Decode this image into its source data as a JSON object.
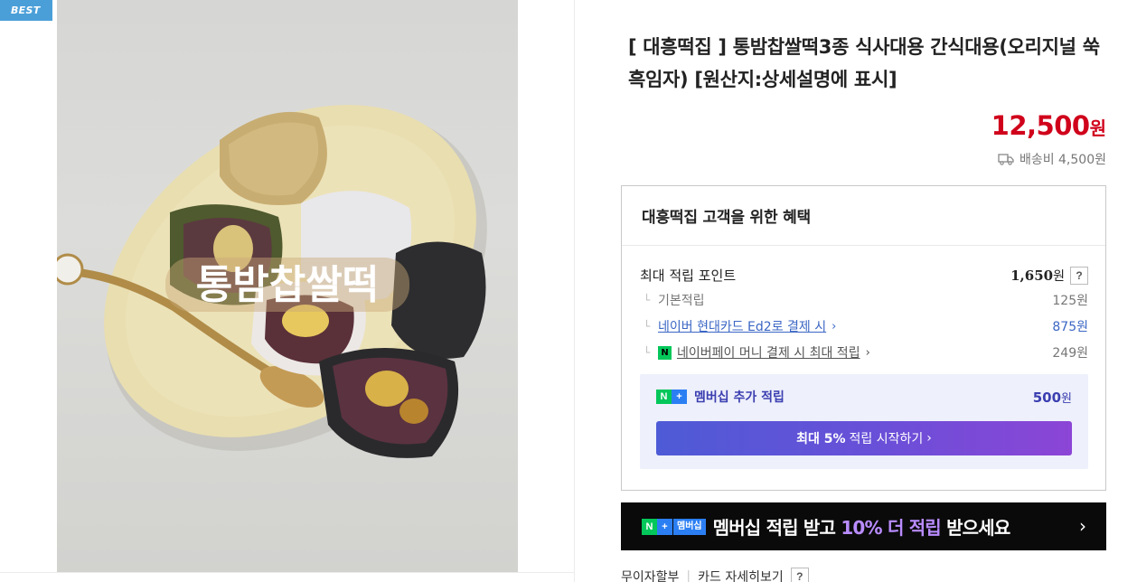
{
  "badge": {
    "label": "BEST"
  },
  "photo": {
    "overlay_text": "통밤찹쌀떡"
  },
  "product": {
    "title": "[ 대흥떡집 ] 통밤찹쌀떡3종 식사대용 간식대용(오리지널 쑥 흑임자) [원산지:상세설명에 표시]",
    "price": "12,500",
    "price_unit": "원",
    "shipping": "배송비 4,500원"
  },
  "benefits": {
    "title": "대흥떡집 고객을 위한 혜택",
    "max_points_label": "최대 적립 포인트",
    "max_points_value": "1,650",
    "max_points_unit": "원",
    "help": "?",
    "rows": [
      {
        "label": "기본적립",
        "value": "125원"
      },
      {
        "label": "네이버 현대카드 Ed2로 결제 시",
        "value": "875원"
      },
      {
        "label": "네이버페이 머니 결제 시 최대 적립",
        "value": "249원"
      }
    ],
    "membership": {
      "label": "멤버십 추가 적립",
      "value": "500",
      "unit": "원",
      "button_bold": "최대 5%",
      "button_rest": "적립 시작하기"
    }
  },
  "banner": {
    "badge": "멤버십",
    "text_a": "멤버십 적립 받고 ",
    "text_highlight": "10% 더 적립",
    "text_b": " 받으세요"
  },
  "bottom_links": {
    "interest_free": "무이자할부",
    "card_details": "카드 자세히보기",
    "help": "?"
  },
  "colors": {
    "price": "#d0021b",
    "accent": "#3b3fb0",
    "badge": "#4a9fd8",
    "naver_green": "#03c75a"
  },
  "icons": [
    "truck-icon",
    "question-icon",
    "npay-icon",
    "chevron-right-icon"
  ]
}
